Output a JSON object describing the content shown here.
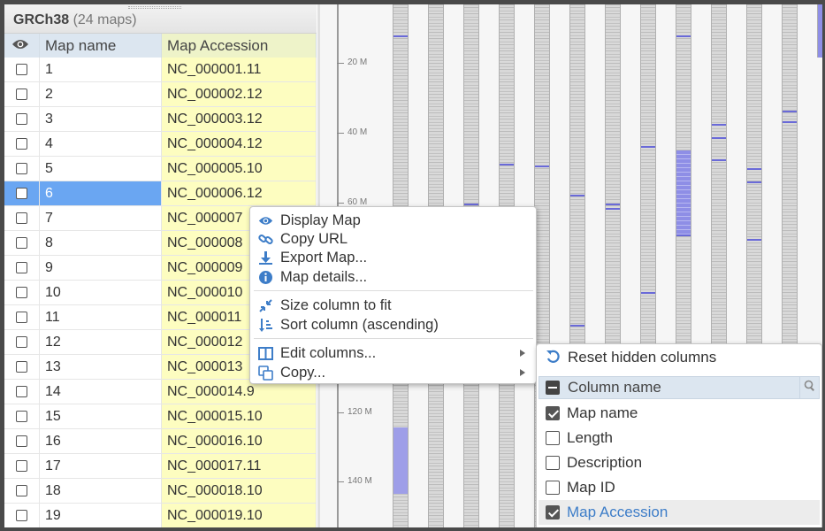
{
  "panel": {
    "title": "GRCh38",
    "count": "(24 maps)"
  },
  "grid": {
    "columns": {
      "visibility_icon": "eye-icon",
      "map_name": "Map name",
      "map_accession": "Map Accession"
    },
    "rows": [
      {
        "name": "1",
        "accession": "NC_000001.11"
      },
      {
        "name": "2",
        "accession": "NC_000002.12"
      },
      {
        "name": "3",
        "accession": "NC_000003.12"
      },
      {
        "name": "4",
        "accession": "NC_000004.12"
      },
      {
        "name": "5",
        "accession": "NC_000005.10"
      },
      {
        "name": "6",
        "accession": "NC_000006.12"
      },
      {
        "name": "7",
        "accession": "NC_000007"
      },
      {
        "name": "8",
        "accession": "NC_000008"
      },
      {
        "name": "9",
        "accession": "NC_000009"
      },
      {
        "name": "10",
        "accession": "NC_000010"
      },
      {
        "name": "11",
        "accession": "NC_000011"
      },
      {
        "name": "12",
        "accession": "NC_000012"
      },
      {
        "name": "13",
        "accession": "NC_000013"
      },
      {
        "name": "14",
        "accession": "NC_000014.9"
      },
      {
        "name": "15",
        "accession": "NC_000015.10"
      },
      {
        "name": "16",
        "accession": "NC_000016.10"
      },
      {
        "name": "17",
        "accession": "NC_000017.11"
      },
      {
        "name": "18",
        "accession": "NC_000018.10"
      },
      {
        "name": "19",
        "accession": "NC_000019.10"
      }
    ],
    "selected_row": "6"
  },
  "ruler": {
    "labels": [
      "20 M",
      "40 M",
      "60 M",
      "120 M",
      "140 M"
    ]
  },
  "context_menu": {
    "items": [
      {
        "label": "Display Map",
        "icon": "eye-icon"
      },
      {
        "label": "Copy URL",
        "icon": "link-icon"
      },
      {
        "label": "Export Map...",
        "icon": "download-icon"
      },
      {
        "label": "Map details...",
        "icon": "info-icon"
      },
      {
        "label": "Size column to fit",
        "icon": "compress-icon"
      },
      {
        "label": "Sort column (ascending)",
        "icon": "sort-ascending-icon"
      },
      {
        "label": "Edit columns...",
        "icon": "columns-icon"
      },
      {
        "label": "Copy...",
        "icon": "copy-icon"
      }
    ]
  },
  "submenu": {
    "reset_label": "Reset hidden columns",
    "header": "Column name",
    "items": [
      {
        "label": "Map name",
        "checked": true
      },
      {
        "label": "Length",
        "checked": false
      },
      {
        "label": "Description",
        "checked": false
      },
      {
        "label": "Map ID",
        "checked": false
      },
      {
        "label": "Map Accession",
        "checked": true
      }
    ]
  },
  "colors": {
    "selection": "#6aa6f2",
    "accession_column": "#fdfdc0",
    "band_highlight": "#6a6ad8",
    "accent": "#3d7dc8"
  }
}
